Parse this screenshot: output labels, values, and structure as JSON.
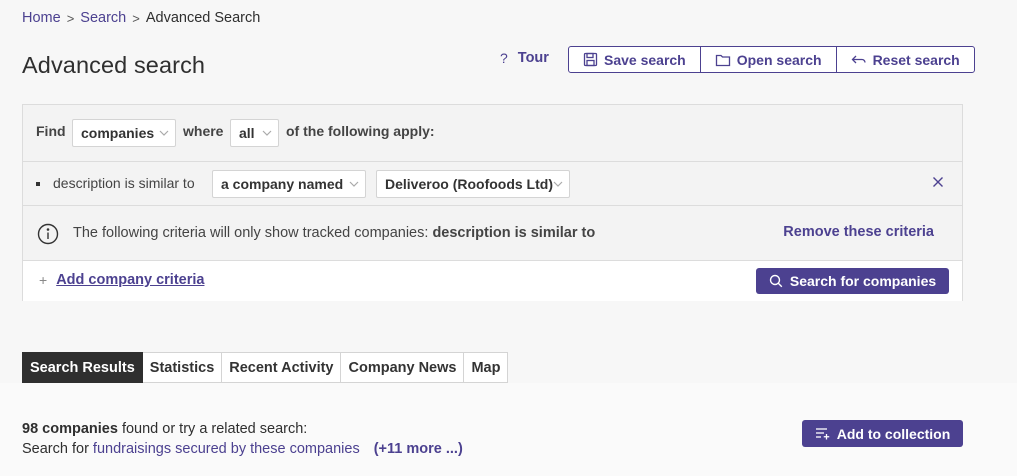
{
  "breadcrumb": {
    "home": "Home",
    "search": "Search",
    "current": "Advanced Search",
    "separator": ">"
  },
  "page": {
    "title": "Advanced search"
  },
  "toolbar": {
    "tour_icon": "?",
    "tour_label": "Tour",
    "save_label": "Save search",
    "open_label": "Open search",
    "reset_label": "Reset search"
  },
  "find": {
    "find_label": "Find",
    "entity_value": "companies",
    "where_label": "where",
    "match_value": "all",
    "apply_label": "of the following apply:"
  },
  "criterion": {
    "label": "description is similar to",
    "mode_value": "a company named",
    "company_value": "Deliveroo (Roofoods Ltd)"
  },
  "notice": {
    "text": "The following criteria will only show tracked companies: ",
    "criteria": "description is similar to",
    "remove_label": "Remove these criteria"
  },
  "actions": {
    "plus": "+",
    "add_criteria_label": "Add company criteria",
    "search_label": "Search for companies"
  },
  "tabs": [
    {
      "label": "Search Results",
      "active": true
    },
    {
      "label": "Statistics",
      "active": false
    },
    {
      "label": "Recent Activity",
      "active": false
    },
    {
      "label": "Company News",
      "active": false
    },
    {
      "label": "Map",
      "active": false
    }
  ],
  "results": {
    "count": "98 companies",
    "found_text": " found or try a related search:",
    "search_for": "Search for ",
    "related_link": "fundraisings secured by these companies",
    "more_link": "(+11 more ...)",
    "add_to_collection_label": "Add to collection"
  },
  "colors": {
    "accent": "#4c4190",
    "tab_active_bg": "#2f2f2f",
    "background": "#f7f7f7"
  }
}
